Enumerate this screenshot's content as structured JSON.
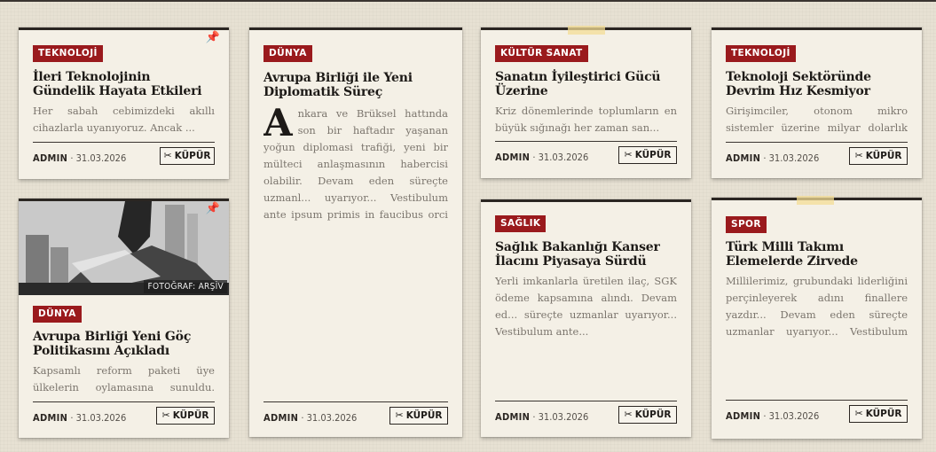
{
  "cards": [
    {
      "category": "TEKNOLOJİ",
      "title": "İleri Teknolojinin Gündelik Hayata Etkileri",
      "excerpt": "Her sabah cebimizdeki akıllı cihazlarla uyanıyoruz. Ancak ...",
      "author": "ADMIN",
      "date": " · 31.03.2026",
      "clip_label": "KÜPÜR",
      "pin_icon": "📌"
    },
    {
      "category": "DÜNYA",
      "title": "Avrupa Birliği ile Yeni Diplomatik Süreç",
      "dropcap": "A",
      "excerpt": "nkara ve Brüksel hattında son bir haftadır yaşanan yoğun diplomasi trafiği, yeni bir mülteci anlaşmasının habercisi olabilir. Devam eden süreçte uzmanl... uyarıyor... Vestibulum ante ipsum primis in faucibus orci luctus...",
      "author": "ADMIN",
      "date": " · 31.03.2026",
      "clip_label": "KÜPÜR"
    },
    {
      "category": "KÜLTÜR SANAT",
      "title": "Sanatın İyileştirici Gücü Üzerine",
      "excerpt": "Kriz dönemlerinde toplumların en büyük sığınağı her zaman san...",
      "author": "ADMIN",
      "date": " · 31.03.2026",
      "clip_label": "KÜPÜR"
    },
    {
      "category": "TEKNOLOJİ",
      "title": "Teknoloji Sektöründe Devrim Hız Kesmiyor",
      "excerpt": "Girişimciler, otonom mikro sistemler üzerine milyar dolarlık fonl...",
      "author": "ADMIN",
      "date": " · 31.03.2026",
      "clip_label": "KÜPÜR"
    },
    {
      "category": "DÜNYA",
      "title": "Avrupa Birliği Yeni Göç Politikasını Açıkladı",
      "excerpt": "Kapsamlı reform paketi üye ülkelerin oylamasına sunuldu. Devam ed...",
      "author": "ADMIN",
      "date": " · 31.03.2026",
      "clip_label": "KÜPÜR",
      "photo_credit": "FOTOĞRAF: ARŞİV",
      "pin_icon": "📌"
    },
    {
      "category": "SAĞLIK",
      "title": "Sağlık Bakanlığı Kanser İlacını Piyasaya Sürdü",
      "excerpt": "Yerli imkanlarla üretilen ilaç, SGK ödeme kapsamına alındı. Devam ed... süreçte uzmanlar uyarıyor... Vestibulum ante...",
      "author": "ADMIN",
      "date": " · 31.03.2026",
      "clip_label": "KÜPÜR"
    },
    {
      "category": "SPOR",
      "title": "Türk Milli Takımı Elemelerde Zirvede",
      "excerpt": "Millilerimiz, grubundaki liderliğini perçinleyerek adını finallere yazdır... Devam eden süreçte uzmanlar uyarıyor... Vestibulum ante ipsum...",
      "author": "ADMIN",
      "date": " · 31.03.2026",
      "clip_label": "KÜPÜR"
    }
  ],
  "icons": {
    "clip": "scissors-icon",
    "pin": "pushpin-icon"
  },
  "colors": {
    "badge": "#9a1a1d",
    "paper": "#f4f0e6",
    "ink": "#1d1a17"
  }
}
